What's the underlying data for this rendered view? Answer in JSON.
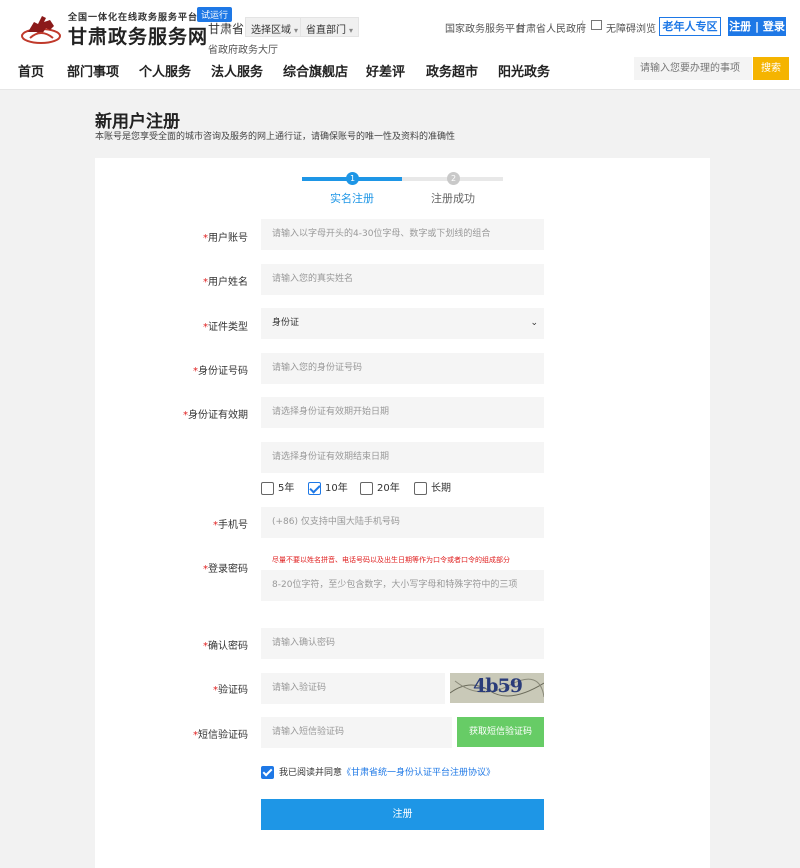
{
  "header": {
    "tagline": "全国一体化在线政务服务平台",
    "badge": "试运行",
    "site_title": "甘肃政务服务网",
    "region_name": "甘肃省",
    "region_select": "选择区域",
    "dept_select": "省直部门",
    "region_hall": "省政府政务大厅",
    "links": [
      "国家政务服务平台",
      "甘肃省人民政府"
    ],
    "separator": "|",
    "accessible": "无障碍浏览",
    "elder_btn": "老年人专区",
    "register_login": "注册 | 登录"
  },
  "nav": {
    "items": [
      "首页",
      "部门事项",
      "个人服务",
      "法人服务",
      "综合旗舰店",
      "好差评",
      "政务超市",
      "阳光政务"
    ],
    "search_placeholder": "请输入您要办理的事项",
    "search_btn": "搜索"
  },
  "page": {
    "title": "新用户注册",
    "subtitle": "本账号是您享受全面的城市咨询及服务的网上通行证，请确保账号的唯一性及资料的准确性"
  },
  "steps": [
    {
      "num": "1",
      "label": "实名注册",
      "active": true
    },
    {
      "num": "2",
      "label": "注册成功",
      "active": false
    }
  ],
  "form": {
    "required_mark": "*",
    "account": {
      "label": "用户账号",
      "placeholder": "请输入以字母开头的4-30位字母、数字或下划线的组合"
    },
    "name": {
      "label": "用户姓名",
      "placeholder": "请输入您的真实姓名"
    },
    "id_type": {
      "label": "证件类型",
      "value": "身份证"
    },
    "id_number": {
      "label": "身份证号码",
      "placeholder": "请输入您的身份证号码"
    },
    "validity": {
      "label": "身份证有效期",
      "start_placeholder": "请选择身份证有效期开始日期",
      "end_placeholder": "请选择身份证有效期结束日期",
      "options": [
        {
          "label": "5年",
          "checked": false
        },
        {
          "label": "10年",
          "checked": true
        },
        {
          "label": "20年",
          "checked": false
        },
        {
          "label": "长期",
          "checked": false
        }
      ]
    },
    "phone": {
      "label": "手机号",
      "placeholder": "(+86) 仅支持中国大陆手机号码"
    },
    "password": {
      "label": "登录密码",
      "hint": "尽量不要以姓名拼音、电话号码以及出生日期等作为口令或者口令的组成部分",
      "placeholder": "8-20位字符，至少包含数字，大小写字母和特殊字符中的三项"
    },
    "confirm": {
      "label": "确认密码",
      "placeholder": "请输入确认密码"
    },
    "captcha": {
      "label": "验证码",
      "placeholder": "请输入验证码",
      "image_text": "4b59"
    },
    "sms": {
      "label": "短信验证码",
      "placeholder": "请输入短信验证码",
      "button": "获取短信验证码"
    },
    "agreement": {
      "prefix": "我已阅读并同意",
      "link": "《甘肃省统一身份认证平台注册协议》"
    },
    "submit": "注册"
  },
  "colors": {
    "accent": "#1e78e6",
    "search_btn": "#f5b400",
    "sms_btn": "#67cc66",
    "required": "#e02020"
  }
}
